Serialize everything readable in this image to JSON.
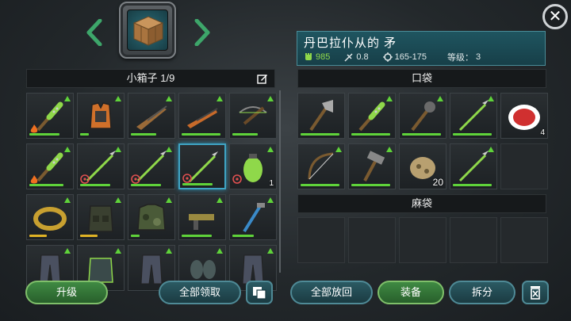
{
  "top": {
    "prev_icon": "chevron-left-icon",
    "next_icon": "chevron-right-icon",
    "crate_icon": "wooden-crate-icon",
    "close_label": "✕",
    "accent": "#3da66a"
  },
  "item_info": {
    "name": "丹巴拉仆从的 矛",
    "power": "985",
    "speed": "0.8",
    "damage": "165-175",
    "level_label": "等级：",
    "level": "3"
  },
  "left_panel": {
    "title": "小箱子  1/9",
    "slots": [
      {
        "item": "spiked-bat",
        "upgrade": true,
        "mod": "fire",
        "bar": 0.7
      },
      {
        "item": "orange-vest",
        "upgrade": true,
        "bar": 0.2
      },
      {
        "item": "rifle",
        "upgrade": true,
        "bar": 0.6
      },
      {
        "item": "shotgun",
        "upgrade": true,
        "bar": 0.9
      },
      {
        "item": "crossbow",
        "upgrade": true,
        "bar": 0.6
      },
      {
        "item": "spiked-bat",
        "upgrade": true,
        "mod": "fire",
        "bar": 0.8
      },
      {
        "item": "spear",
        "upgrade": true,
        "mod": "biohazard",
        "bar": 0.7
      },
      {
        "item": "spear",
        "upgrade": true,
        "mod": "biohazard",
        "bar": 0.7
      },
      {
        "item": "spear",
        "upgrade": false,
        "mod": "biohazard",
        "bar": 0.7,
        "selected": true
      },
      {
        "item": "grenade",
        "upgrade": true,
        "mod": "biohazard",
        "qty": "1"
      },
      {
        "item": "belt",
        "upgrade": true,
        "bar": 0.4,
        "bar_color": "yellow"
      },
      {
        "item": "tactical-vest",
        "upgrade": true,
        "bar": 0.4,
        "bar_color": "yellow"
      },
      {
        "item": "camo-jacket",
        "upgrade": true,
        "bar": 0.2
      },
      {
        "item": "smg",
        "upgrade": true,
        "bar": 0.7
      },
      {
        "item": "pipe-wrench",
        "upgrade": true,
        "bar": 0.5
      },
      {
        "item": "pants",
        "upgrade": true
      },
      {
        "item": "armor",
        "upgrade": true
      },
      {
        "item": "pants",
        "upgrade": true
      },
      {
        "item": "gloves",
        "upgrade": true
      },
      {
        "item": "pants",
        "upgrade": true
      }
    ]
  },
  "right_panel": {
    "pocket_title": "口袋",
    "pocket_slots": [
      {
        "item": "axe",
        "bar": 0.9
      },
      {
        "item": "spiked-bat",
        "upgrade": true,
        "bar": 0.9
      },
      {
        "item": "mace",
        "upgrade": true,
        "bar": 0.9
      },
      {
        "item": "spear",
        "upgrade": true,
        "bar": 0.9
      },
      {
        "item": "tomato-soup",
        "qty": "4"
      },
      {
        "item": "bow",
        "upgrade": true,
        "bar": 0.9
      },
      {
        "item": "hammer",
        "upgrade": true,
        "bar": 0.9
      },
      {
        "item": "ore",
        "qty": "20"
      },
      {
        "item": "spear",
        "upgrade": true,
        "bar": 0.9
      },
      {
        "item": "empty"
      }
    ],
    "bag_title": "麻袋",
    "bag_slots": 5
  },
  "buttons": {
    "upgrade": "升级",
    "take_all": "全部领取",
    "stack_icon": "stack-icon",
    "return_all": "全部放回",
    "equip": "装备",
    "split": "拆分",
    "trash_icon": "trash-icon"
  }
}
